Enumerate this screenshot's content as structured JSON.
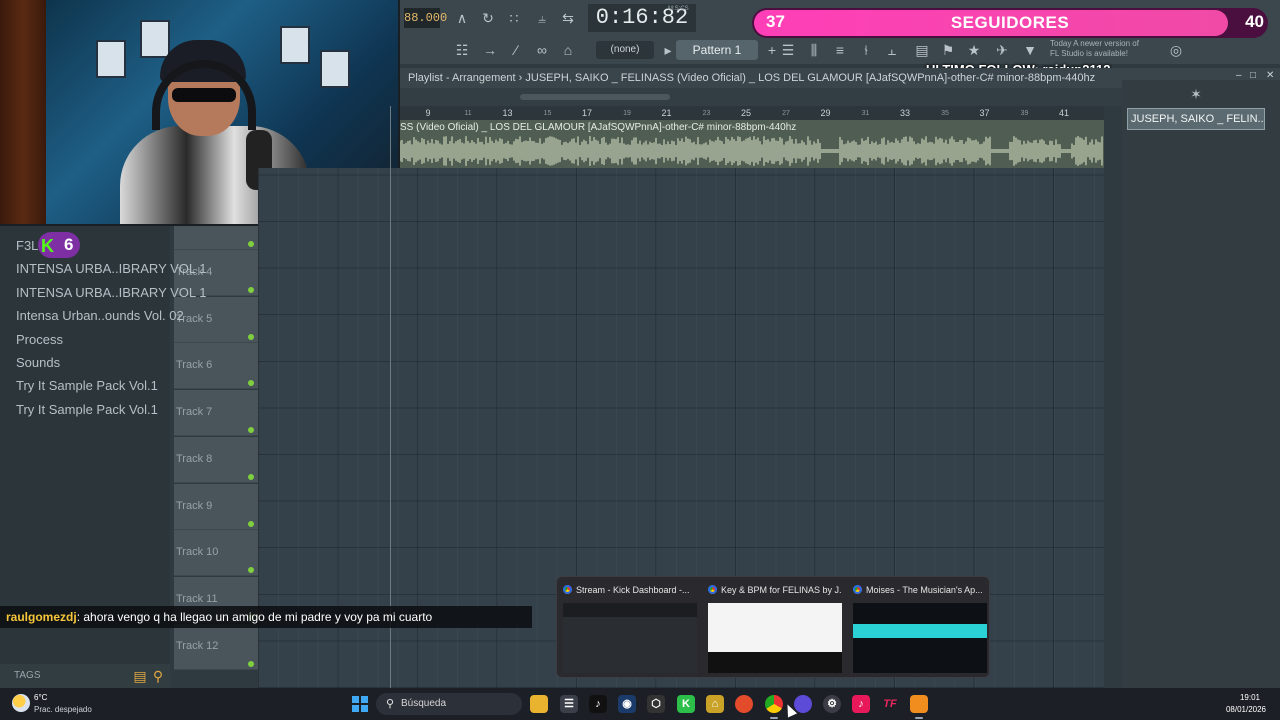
{
  "toolbar": {
    "tempo": "88.000",
    "time": "0:16:82",
    "time_unit": "M:S:CS",
    "pattern_none": "(none)",
    "pattern": "Pattern 1",
    "update_notice_1": "Today  A newer version of",
    "update_notice_2": "FL Studio is available!"
  },
  "followers": {
    "current": "37",
    "label": "SEGUIDORES",
    "goal": "40",
    "progress": 0.925,
    "last_follow": "ULTIMO FOLLOW: raidup2112"
  },
  "playlist": {
    "title": "Playlist - Arrangement › JUSEPH, SAIKO _ FELINASS (Video Oficial) _ LOS DEL GLAMOUR [AJafSQWPnnA]-other-C# minor-88bpm-440hz",
    "ruler_major": [
      "9",
      "13",
      "17",
      "21",
      "25",
      "29",
      "33",
      "37",
      "41"
    ],
    "ruler_minor": [
      "11",
      "15",
      "19",
      "23",
      "27",
      "31",
      "35",
      "39"
    ],
    "clip_name": "SS (Video Oficial) _ LOS DEL GLAMOUR [AJafSQWPnnA]-other-C# minor-88bpm-440hz",
    "tracks": [
      "Track 4",
      "Track 5",
      "Track 6",
      "Track 7",
      "Track 8",
      "Track 9",
      "Track 10",
      "Track 11",
      "Track 12"
    ],
    "channel_name": "JUSEPH, SAIKO _ FELIN..."
  },
  "browser": {
    "items": [
      "F3L",
      "INTENSA URBA..IBRARY VOL 1",
      "INTENSA URBA..IBRARY VOL 1",
      "Intensa Urban..ounds Vol. 02",
      "Process",
      "Sounds",
      "Try It Sample Pack Vol.1",
      "Try It Sample Pack Vol.1"
    ],
    "tags_label": "TAGS"
  },
  "kick": {
    "count": "6",
    "icon": "K"
  },
  "chat": {
    "user": "raulgomezdj",
    "message": ": ahora vengo q ha llegao un amigo de mi padre y voy pa mi cuarto"
  },
  "thumbnails": [
    {
      "title": "Stream - Kick Dashboard -..."
    },
    {
      "title": "Key & BPM for FELINAS by J..."
    },
    {
      "title": "Moises - The Musician's Ap..."
    }
  ],
  "taskbar": {
    "temperature": "6°C",
    "condition": "Prac. despejado",
    "search_placeholder": "Búsqueda",
    "time": "19:01",
    "date": "08/01/2026"
  },
  "colors": {
    "follow_bar": "#ff3fb8",
    "kick_green": "#53fc18",
    "track_led": "#7fcf3f"
  }
}
